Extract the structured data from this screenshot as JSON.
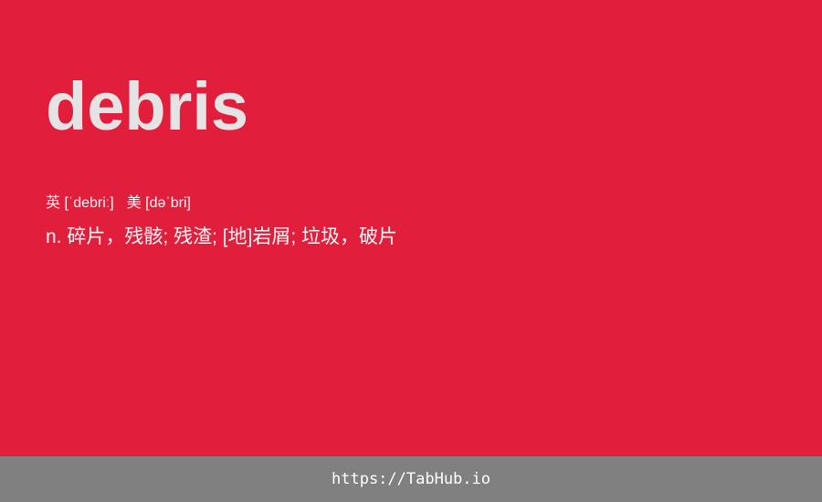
{
  "card": {
    "word": "debris",
    "phonetic_uk": "英 [ˈdebriː]",
    "phonetic_us": "美 [dəˈbri]",
    "definition": "n. 碎片，残骸; 残渣; [地]岩屑; 垃圾，破片"
  },
  "footer": {
    "link_text": "https://TabHub.io"
  },
  "colors": {
    "background": "#e11e3c",
    "footer": "#808080",
    "word": "#e4e4e4"
  }
}
